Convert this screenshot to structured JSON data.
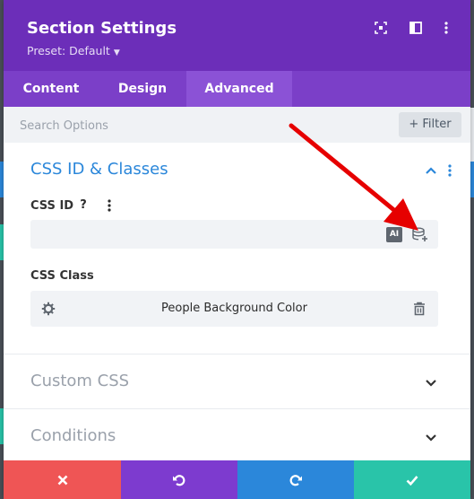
{
  "modal": {
    "title": "Section Settings",
    "preset_label": "Preset: Default",
    "header_icons": [
      "fullscreen-icon",
      "sidebar-layout-icon",
      "more-vertical-icon"
    ]
  },
  "tabs": [
    {
      "label": "Content",
      "active": false
    },
    {
      "label": "Design",
      "active": false
    },
    {
      "label": "Advanced",
      "active": true
    }
  ],
  "search": {
    "placeholder": "Search Options",
    "value": "",
    "filter_label": "+ Filter"
  },
  "sections": {
    "css_id_classes": {
      "title": "CSS ID & Classes",
      "expanded": true,
      "css_id": {
        "label": "CSS ID",
        "help_glyph": "?",
        "value": "",
        "ai_badge": "AI"
      },
      "css_class": {
        "label": "CSS Class",
        "value": "People Background Color"
      }
    },
    "custom_css": {
      "title": "Custom CSS",
      "expanded": false
    },
    "conditions": {
      "title": "Conditions",
      "expanded": false
    }
  },
  "footer": {
    "buttons": [
      {
        "name": "discard",
        "icon": "close-icon",
        "color": "#ef5555"
      },
      {
        "name": "undo",
        "icon": "undo-icon",
        "color": "#7d3bcf"
      },
      {
        "name": "redo",
        "icon": "redo-icon",
        "color": "#2b87da"
      },
      {
        "name": "save",
        "icon": "check-icon",
        "color": "#29c4a9"
      }
    ]
  },
  "colors": {
    "header_purple": "#6c2eb9",
    "tab_bar_purple": "#7b3fc8",
    "active_tab": "#8b52d6",
    "section_title_blue": "#2b87da",
    "collapsed_title_gray": "#9aa1ab",
    "annotation_red": "#e60000"
  }
}
